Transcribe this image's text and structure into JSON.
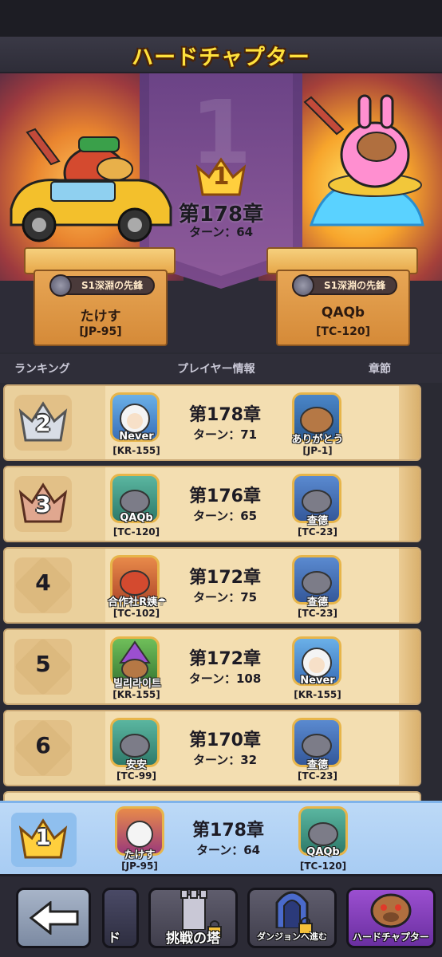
{
  "title": "ハードチャプター",
  "top": {
    "rank": "1",
    "chapter": "第178章",
    "turns": "ターン：64",
    "left": {
      "badge": "S1深淵の先鋒",
      "name": "たけす",
      "server": "[JP-95]"
    },
    "right": {
      "badge": "S1深淵の先鋒",
      "name": "QAQb",
      "server": "[TC-120]"
    }
  },
  "columns": {
    "ranking": "ランキング",
    "player_info": "プレイヤー情報",
    "chapter": "章節"
  },
  "rows": [
    {
      "rank": "2",
      "p1": {
        "name": "Never",
        "server": "[KR-155]"
      },
      "chapter": "第178章",
      "turns": "ターン：71",
      "p2": {
        "name": "ありがとう",
        "server": "[JP-1]"
      }
    },
    {
      "rank": "3",
      "p1": {
        "name": "QAQb",
        "server": "[TC-120]"
      },
      "chapter": "第176章",
      "turns": "ターン：65",
      "p2": {
        "name": "查德",
        "server": "[TC-23]"
      }
    },
    {
      "rank": "4",
      "p1": {
        "name": "合作社R姨☂",
        "server": "[TC-102]"
      },
      "chapter": "第172章",
      "turns": "ターン：75",
      "p2": {
        "name": "查德",
        "server": "[TC-23]"
      }
    },
    {
      "rank": "5",
      "p1": {
        "name": "빌리라이트",
        "server": "[KR-155]"
      },
      "chapter": "第172章",
      "turns": "ターン：108",
      "p2": {
        "name": "Never",
        "server": "[KR-155]"
      }
    },
    {
      "rank": "6",
      "p1": {
        "name": "安安",
        "server": "[TC-99]"
      },
      "chapter": "第170章",
      "turns": "ターン：32",
      "p2": {
        "name": "查德",
        "server": "[TC-23]"
      }
    }
  ],
  "me": {
    "rank": "1",
    "name": "たけす",
    "server": "[JP-95]",
    "chapter": "第178章",
    "turns": "ターン：64",
    "p2": {
      "name": "QAQb",
      "server": "[TC-120]"
    }
  },
  "nav": {
    "back_icon": "arrow-left-icon",
    "partial_label": "ド",
    "tower_label": "挑戦の塔",
    "dungeon_label": "ダンジョンへ進む",
    "hard_label": "ハードチャプター"
  },
  "colors": {
    "gold": "#ffe23d",
    "row_bg": "#f3deb1",
    "my_row_bg": "#bcd9f7",
    "dark": "#2b2a35"
  }
}
